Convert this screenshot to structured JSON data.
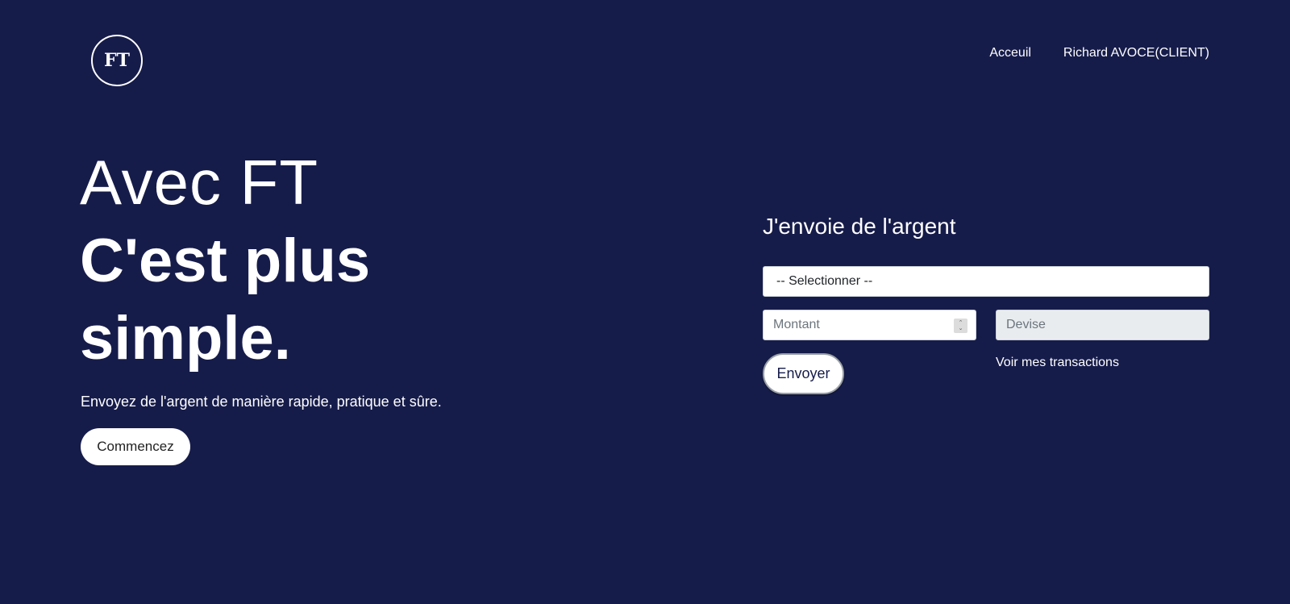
{
  "header": {
    "logo_text": "FT",
    "nav": [
      {
        "label": "Acceuil"
      },
      {
        "label": "Richard AVOCE(CLIENT)"
      }
    ]
  },
  "hero": {
    "line1": "Avec FT",
    "line2": "C'est plus simple.",
    "tagline": "Envoyez de l'argent de manière rapide, pratique et sûre.",
    "cta_label": "Commencez"
  },
  "form": {
    "title": "J'envoie de l'argent",
    "select_value": "-- Selectionner --",
    "amount_placeholder": "Montant",
    "currency_placeholder": "Devise",
    "send_label": "Envoyer",
    "transactions_link": "Voir mes transactions"
  },
  "colors": {
    "background": "#161c4a",
    "text": "#ffffff",
    "button_bg": "#ffffff"
  },
  "icons": {
    "number_spinner": "up-down-chevron-icon"
  }
}
